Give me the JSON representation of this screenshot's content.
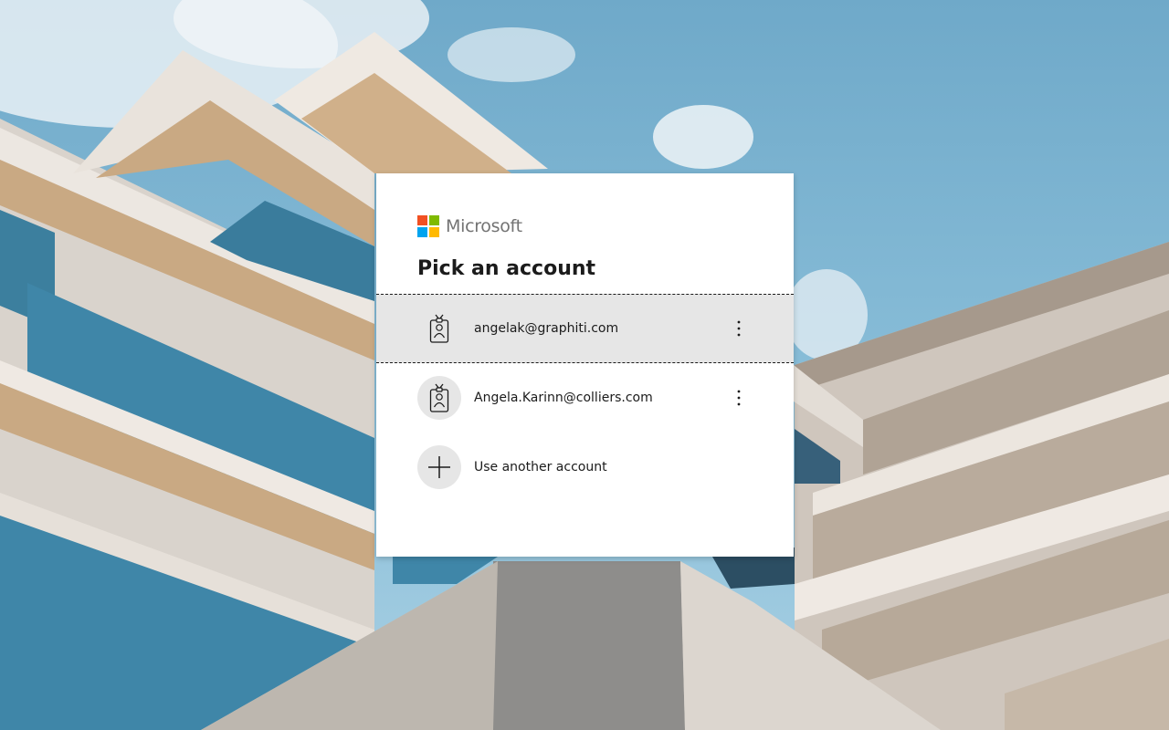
{
  "brand": {
    "name": "Microsoft",
    "logo_colors": [
      "#f25022",
      "#7fba00",
      "#00a4ef",
      "#ffb900"
    ]
  },
  "title": "Pick an account",
  "accounts": [
    {
      "email": "angelak@graphiti.com",
      "icon": "work-badge-icon",
      "selected": true
    },
    {
      "email": "Angela.Karinn@colliers.com",
      "icon": "work-badge-icon",
      "selected": false
    }
  ],
  "add_account": {
    "label": "Use another account",
    "icon": "plus-icon"
  },
  "more_options_icon": "more-vertical-icon",
  "colors": {
    "selected_row_bg": "#e6e6e6",
    "text": "#1b1b1b",
    "brand_text": "#737373",
    "sky": "#7ab4d2"
  }
}
